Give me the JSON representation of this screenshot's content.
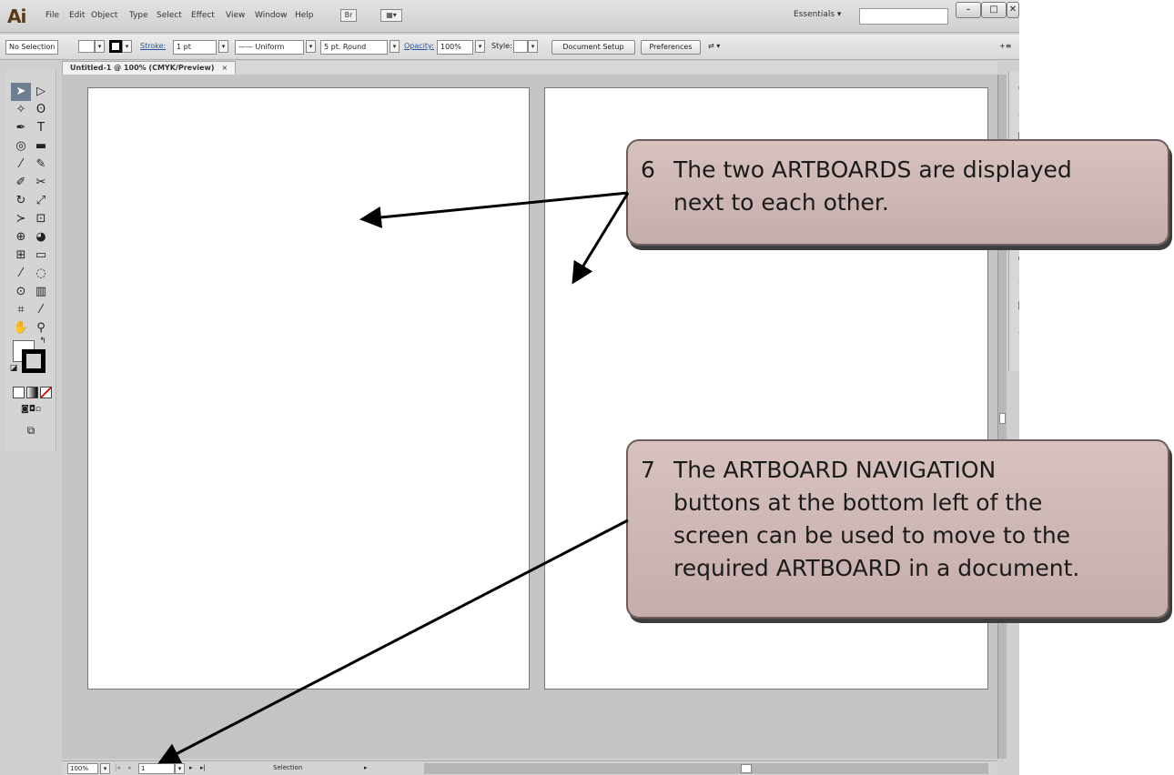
{
  "menubar": {
    "logo": "Ai",
    "items": [
      "File",
      "Edit",
      "Object",
      "Type",
      "Select",
      "Effect",
      "View",
      "Window",
      "Help"
    ],
    "workspace": "Essentials",
    "workspace_caret": "▾",
    "window_buttons": [
      "–",
      "□",
      "✕"
    ]
  },
  "controlbar": {
    "selection": "No Selection",
    "stroke_label": "Stroke:",
    "stroke_value": "1 pt",
    "profile": "Uniform",
    "brush": "5 pt. Round",
    "opacity_label": "Opacity:",
    "opacity_value": "100%",
    "style_label": "Style:",
    "document_setup": "Document Setup",
    "preferences": "Preferences",
    "panel_toggle": "+≡"
  },
  "document_tab": {
    "title": "Untitled-1 @ 100% (CMYK/Preview)",
    "close": "×"
  },
  "statusbar": {
    "zoom": "100%",
    "artboard_number": "1",
    "status": "Selection",
    "nav_first": "|◂",
    "nav_prev": "◂",
    "nav_next": "▸",
    "nav_last": "▸|"
  },
  "callouts": [
    {
      "number": "6",
      "lines": [
        "The two ARTBOARDS are displayed",
        "next to each other."
      ]
    },
    {
      "number": "7",
      "lines": [
        "The ARTBOARD NAVIGATION",
        "buttons at the bottom left of the",
        "screen can be used to move to the",
        "required ARTBOARD in a document."
      ]
    }
  ],
  "colors": {
    "callout_fill": "#cdb7b5",
    "callout_border": "#6e5d5c",
    "arrow": "#000000",
    "artboard": "#ffffff",
    "pasteboard": "#c4c4c4"
  }
}
